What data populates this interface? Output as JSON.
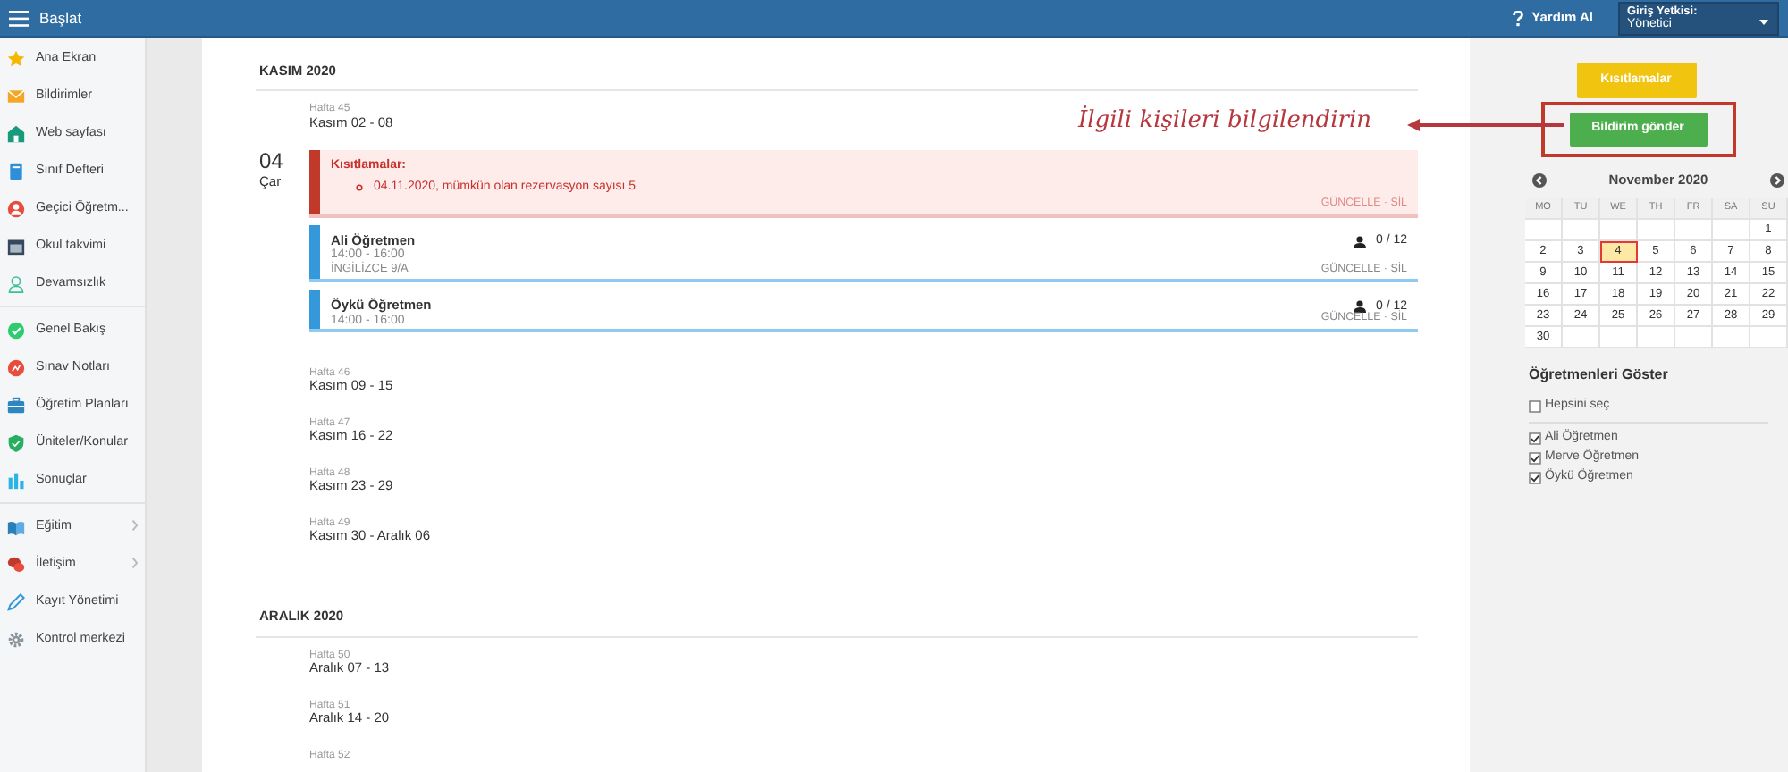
{
  "topbar": {
    "title": "Başlat",
    "help": "Yardım Al",
    "role": {
      "label": "Giriş Yetkisi:",
      "value": "Yönetici"
    }
  },
  "sidebar": {
    "groups": [
      [
        {
          "label": "Ana Ekran",
          "has_submenu": false
        },
        {
          "label": "Bildirimler",
          "has_submenu": false
        },
        {
          "label": "Web sayfası",
          "has_submenu": false
        },
        {
          "label": "Sınıf Defteri",
          "has_submenu": false
        },
        {
          "label": "Geçici Öğretm...",
          "has_submenu": false
        },
        {
          "label": "Okul takvimi",
          "has_submenu": false
        },
        {
          "label": "Devamsızlık",
          "has_submenu": false
        }
      ],
      [
        {
          "label": "Genel Bakış",
          "has_submenu": false
        },
        {
          "label": "Sınav Notları",
          "has_submenu": false
        },
        {
          "label": "Öğretim Planları",
          "has_submenu": false
        },
        {
          "label": "Üniteler/Konular",
          "has_submenu": false
        },
        {
          "label": "Sonuçlar",
          "has_submenu": false
        }
      ],
      [
        {
          "label": "Eğitim",
          "has_submenu": true
        },
        {
          "label": "İletişim",
          "has_submenu": true
        },
        {
          "label": "Kayıt Yönetimi",
          "has_submenu": false
        },
        {
          "label": "Kontrol merkezi",
          "has_submenu": false
        }
      ]
    ]
  },
  "months": [
    {
      "title": "KASIM 2020",
      "weeks": [
        {
          "week": "Hafta 45",
          "range": "Kasım 02 - 08",
          "days": [
            {
              "day": "04",
              "weekday": "Çar",
              "events": [
                {
                  "kind": "restriction",
                  "title": "Kısıtlamalar:",
                  "items": [
                    "04.11.2020, mümkün olan rezervasyon sayısı 5"
                  ],
                  "actions": [
                    "GÜNCELLE",
                    "SİL"
                  ],
                  "separator": "·"
                },
                {
                  "kind": "lesson",
                  "teacher": "Ali Öğretmen",
                  "time": "14:00 - 16:00",
                  "class": "İNGİLİZCE 9/A",
                  "count": "0 / 12",
                  "actions": [
                    "GÜNCELLE",
                    "SİL"
                  ],
                  "separator": "·"
                },
                {
                  "kind": "lesson",
                  "teacher": "Öykü Öğretmen",
                  "time": "14:00 - 16:00",
                  "count": "0 / 12",
                  "actions": [
                    "GÜNCELLE",
                    "SİL"
                  ],
                  "separator": "·"
                }
              ]
            }
          ]
        },
        {
          "week": "Hafta 46",
          "range": "Kasım 09 - 15"
        },
        {
          "week": "Hafta 47",
          "range": "Kasım 16 - 22"
        },
        {
          "week": "Hafta 48",
          "range": "Kasım 23 - 29"
        },
        {
          "week": "Hafta 49",
          "range": "Kasım 30 - Aralık 06"
        }
      ]
    },
    {
      "title": "ARALIK 2020",
      "weeks": [
        {
          "week": "Hafta 50",
          "range": "Aralık 07 - 13"
        },
        {
          "week": "Hafta 51",
          "range": "Aralık 14 - 20"
        },
        {
          "week": "Hafta 52"
        }
      ]
    }
  ],
  "annotation": "İlgili kişileri bilgilendirin",
  "right_panel": {
    "buttons": [
      {
        "label": "Kısıtlamalar",
        "kind": "warning",
        "highlighted": false
      },
      {
        "label": "Bildirim gönder",
        "kind": "success",
        "highlighted": true
      }
    ],
    "calendar": {
      "title": "November 2020",
      "weekdays": [
        "MO",
        "TU",
        "WE",
        "TH",
        "FR",
        "SA",
        "SU"
      ],
      "weeks": [
        [
          {
            "kind": "blank"
          },
          {
            "kind": "blank"
          },
          {
            "kind": "blank"
          },
          {
            "kind": "blank"
          },
          {
            "kind": "blank"
          },
          {
            "kind": "blank"
          },
          {
            "kind": "day",
            "day": "1",
            "selected": false
          }
        ],
        [
          {
            "kind": "day",
            "day": "2",
            "selected": false
          },
          {
            "kind": "day",
            "day": "3",
            "selected": false
          },
          {
            "kind": "day",
            "day": "4",
            "selected": true
          },
          {
            "kind": "day",
            "day": "5",
            "selected": false
          },
          {
            "kind": "day",
            "day": "6",
            "selected": false
          },
          {
            "kind": "day",
            "day": "7",
            "selected": false
          },
          {
            "kind": "day",
            "day": "8",
            "selected": false
          }
        ],
        [
          {
            "kind": "day",
            "day": "9",
            "selected": false
          },
          {
            "kind": "day",
            "day": "10",
            "selected": false
          },
          {
            "kind": "day",
            "day": "11",
            "selected": false
          },
          {
            "kind": "day",
            "day": "12",
            "selected": false
          },
          {
            "kind": "day",
            "day": "13",
            "selected": false
          },
          {
            "kind": "day",
            "day": "14",
            "selected": false
          },
          {
            "kind": "day",
            "day": "15",
            "selected": false
          }
        ],
        [
          {
            "kind": "day",
            "day": "16",
            "selected": false
          },
          {
            "kind": "day",
            "day": "17",
            "selected": false
          },
          {
            "kind": "day",
            "day": "18",
            "selected": false
          },
          {
            "kind": "day",
            "day": "19",
            "selected": false
          },
          {
            "kind": "day",
            "day": "20",
            "selected": false
          },
          {
            "kind": "day",
            "day": "21",
            "selected": false
          },
          {
            "kind": "day",
            "day": "22",
            "selected": false
          }
        ],
        [
          {
            "kind": "day",
            "day": "23",
            "selected": false
          },
          {
            "kind": "day",
            "day": "24",
            "selected": false
          },
          {
            "kind": "day",
            "day": "25",
            "selected": false
          },
          {
            "kind": "day",
            "day": "26",
            "selected": false
          },
          {
            "kind": "day",
            "day": "27",
            "selected": false
          },
          {
            "kind": "day",
            "day": "28",
            "selected": false
          },
          {
            "kind": "day",
            "day": "29",
            "selected": false
          }
        ],
        [
          {
            "kind": "day",
            "day": "30",
            "selected": false
          },
          {
            "kind": "blank"
          },
          {
            "kind": "blank"
          },
          {
            "kind": "blank"
          },
          {
            "kind": "blank"
          },
          {
            "kind": "blank"
          },
          {
            "kind": "blank"
          }
        ]
      ]
    },
    "teachers": {
      "title": "Öğretmenleri Göster",
      "select_all": {
        "label": "Hepsini seç",
        "checked": false
      },
      "items": [
        {
          "label": "Ali Öğretmen",
          "checked": true
        },
        {
          "label": "Merve Öğretmen",
          "checked": true
        },
        {
          "label": "Öykü Öğretmen",
          "checked": true
        }
      ]
    }
  }
}
